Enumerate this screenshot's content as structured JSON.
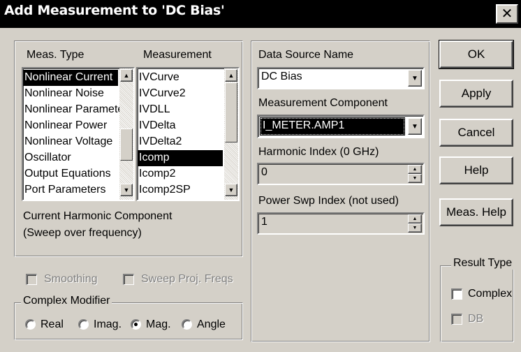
{
  "dialog": {
    "title": "Add Measurement to 'DC Bias'",
    "close_glyph": "✕"
  },
  "meas_type": {
    "header": "Meas. Type",
    "items": [
      "Nonlinear Current",
      "Nonlinear Noise",
      "Nonlinear Paramete",
      "Nonlinear Power",
      "Nonlinear Voltage",
      "Oscillator",
      "Output Equations",
      "Port Parameters"
    ],
    "selected_index": 0
  },
  "measurement": {
    "header": "Measurement",
    "items": [
      "IVCurve",
      "IVCurve2",
      "IVDLL",
      "IVDelta",
      "IVDelta2",
      "Icomp",
      "Icomp2",
      "Icomp2SP"
    ],
    "selected_index": 5
  },
  "description": {
    "line1": "Current Harmonic Component",
    "line2": "(Sweep over frequency)"
  },
  "options": {
    "smoothing": "Smoothing",
    "sweep_proj": "Sweep Proj. Freqs"
  },
  "complex_modifier": {
    "legend": "Complex Modifier",
    "real": "Real",
    "imag": "Imag.",
    "mag": "Mag.",
    "angle": "Angle",
    "selected": "Mag."
  },
  "right_panel": {
    "data_source_label": "Data Source Name",
    "data_source_value": "DC Bias",
    "component_label": "Measurement Component",
    "component_value": "I_METER.AMP1",
    "harmonic_label": "Harmonic Index (0 GHz)",
    "harmonic_value": "0",
    "power_swp_label": "Power Swp Index (not used)",
    "power_swp_value": "1"
  },
  "buttons": {
    "ok": "OK",
    "apply": "Apply",
    "cancel": "Cancel",
    "help": "Help",
    "meas_help": "Meas. Help"
  },
  "result_type": {
    "legend": "Result Type",
    "complex": "Complex",
    "db": "DB"
  }
}
